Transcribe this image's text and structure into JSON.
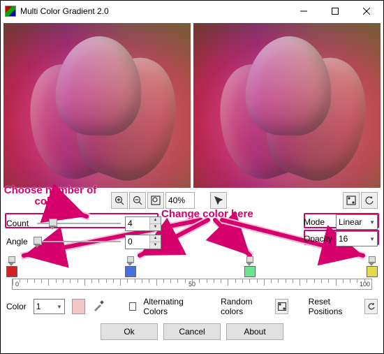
{
  "title": "Multi Color Gradient 2.0",
  "zoom_level": "40%",
  "count": {
    "label": "Count",
    "value": "4",
    "slider_pos_pct": 18
  },
  "angle": {
    "label": "Angle",
    "value": "0",
    "slider_pos_pct": 0
  },
  "mode": {
    "label": "Mode",
    "value": "Linear"
  },
  "opacity": {
    "label": "Opacity",
    "value": "16"
  },
  "stops": [
    {
      "pos": 0,
      "color": "#d32222"
    },
    {
      "pos": 33,
      "color": "#4a6fe0"
    },
    {
      "pos": 66,
      "color": "#6de28f"
    },
    {
      "pos": 100,
      "color": "#e6d84a"
    }
  ],
  "ruler": {
    "min": "0",
    "mid": "50",
    "max": "100"
  },
  "color_row": {
    "label": "Color",
    "selected": "1",
    "swatch_color": "#f3c8c8",
    "alt_label": "Alternating Colors",
    "random_label": "Random colors",
    "reset_label": "Reset Positions"
  },
  "buttons": {
    "ok": "Ok",
    "cancel": "Cancel",
    "about": "About"
  },
  "annotations": {
    "choose": "Choose number of\ncolors",
    "change": "Change color here"
  }
}
